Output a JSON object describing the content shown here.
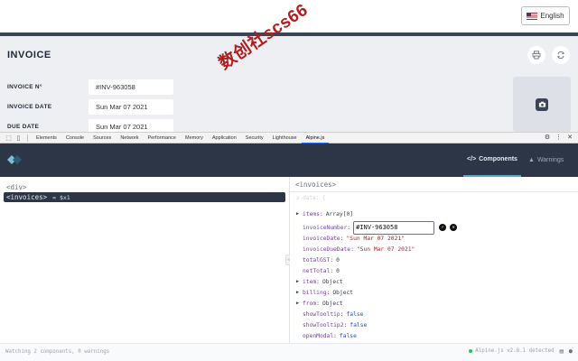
{
  "language_button": {
    "label": "English",
    "flag_icon": "us-flag-icon"
  },
  "invoice": {
    "title": "INVOICE",
    "fields": [
      {
        "label": "INVOICE N°",
        "value": "#INV-963058"
      },
      {
        "label": "INVOICE DATE",
        "value": "Sun Mar 07 2021"
      },
      {
        "label": "DUE DATE",
        "value": "Sun Mar 07 2021"
      }
    ],
    "actions": {
      "print_icon": "printer-icon",
      "refresh_icon": "refresh-icon",
      "camera_icon": "camera-icon"
    }
  },
  "watermark": "数创社scs66",
  "devtools": {
    "tabs": [
      "Elements",
      "Console",
      "Sources",
      "Network",
      "Performance",
      "Memory",
      "Application",
      "Security",
      "Lighthouse",
      "Alpine.js"
    ],
    "active_tab": "Alpine.js"
  },
  "alpine": {
    "tabs": {
      "components": "Components",
      "warnings": "Warnings"
    },
    "tree": {
      "root": "<div>",
      "selected": "<invoices>",
      "selected_ref": "= $x1"
    },
    "detail": {
      "header": "<invoices>",
      "data_label": "x-data: {",
      "props": [
        {
          "key": "items",
          "colon": ":",
          "value": "Array[0]",
          "kind": "val",
          "expandable": true
        },
        {
          "key": "invoiceNumber",
          "colon": ":",
          "value": "#INV-963058",
          "kind": "edit",
          "expandable": false
        },
        {
          "key": "invoiceDate",
          "colon": ":",
          "value": "\"Sun Mar 07 2021\"",
          "kind": "str",
          "expandable": false
        },
        {
          "key": "invoiceDueDate",
          "colon": ":",
          "value": "\"Sun Mar 07 2021\"",
          "kind": "str",
          "expandable": false
        },
        {
          "key": "totalGST",
          "colon": ":",
          "value": "0",
          "kind": "num",
          "expandable": false
        },
        {
          "key": "netTotal",
          "colon": ":",
          "value": "0",
          "kind": "num",
          "expandable": false
        },
        {
          "key": "item",
          "colon": ":",
          "value": "Object",
          "kind": "val",
          "expandable": true
        },
        {
          "key": "billing",
          "colon": ":",
          "value": "Object",
          "kind": "val",
          "expandable": true
        },
        {
          "key": "from",
          "colon": ":",
          "value": "Object",
          "kind": "val",
          "expandable": true
        },
        {
          "key": "showTooltip",
          "colon": ":",
          "value": "false",
          "kind": "bool",
          "expandable": false
        },
        {
          "key": "showTooltip2",
          "colon": ":",
          "value": "false",
          "kind": "bool",
          "expandable": false
        },
        {
          "key": "openModal",
          "colon": ":",
          "value": "false",
          "kind": "bool",
          "expandable": false
        }
      ]
    },
    "status": {
      "left": "Watching 2 components, 0 warnings",
      "version": "Alpine.js v2.8.1 detected"
    }
  }
}
